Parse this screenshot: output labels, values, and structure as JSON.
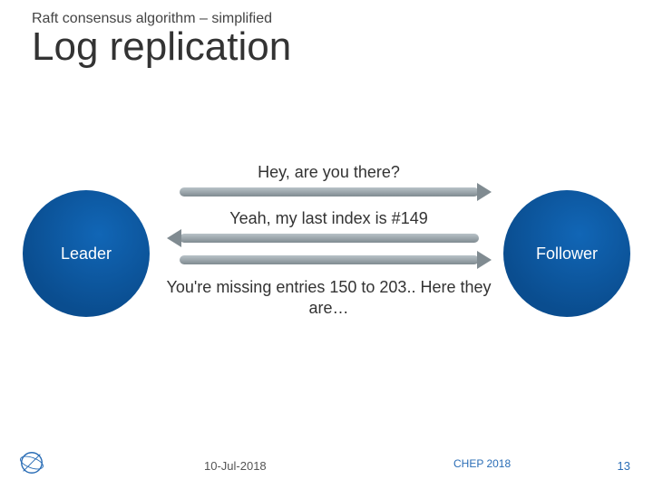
{
  "header": {
    "overtitle": "Raft consensus algorithm – simplified",
    "title": "Log replication"
  },
  "nodes": {
    "leader_label": "Leader",
    "follower_label": "Follower"
  },
  "messages": {
    "m1": "Hey, are you there?",
    "m2": "Yeah, my last index is #149",
    "m3": "You're missing entries 150 to 203.. Here they are…"
  },
  "footer": {
    "date": "10-Jul-2018",
    "conference": "CHEP 2018",
    "page": "13"
  },
  "colors": {
    "accent": "#0e5aa0",
    "link": "#2a6db6"
  }
}
